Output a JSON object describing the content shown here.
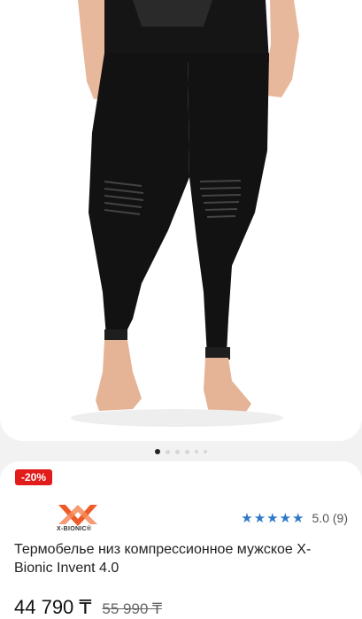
{
  "gallery": {
    "slides": 6,
    "active_index": 0
  },
  "product": {
    "discount_badge": "-20%",
    "brand_logo_text": "X-BIONIC®",
    "rating": {
      "stars": 5,
      "value": "5.0",
      "count": "(9)",
      "star_color": "#2e78c6"
    },
    "title": "Термобелье низ компрессионное мужское X-Bionic Invent 4.0",
    "price": "44 790 ₸",
    "old_price": "55 990 ₸"
  },
  "colors": {
    "badge": "#e21b1b",
    "logo_accent": "#f05a28"
  }
}
